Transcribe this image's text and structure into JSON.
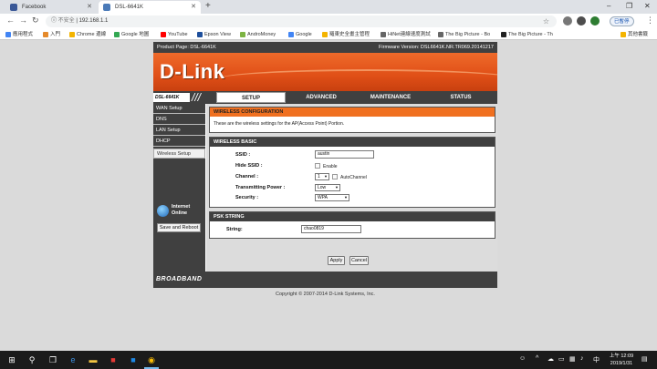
{
  "browser": {
    "tabs": [
      {
        "label": "Facebook",
        "color": "#3b5998"
      },
      {
        "label": "DSL-6641K",
        "color": "#4a7ab8"
      }
    ],
    "new_tab": "+",
    "window_controls": {
      "minimize": "–",
      "maximize": "❐",
      "close": "✕"
    },
    "url_insecure": "不安全",
    "url": "192.168.1.1",
    "profile_label": "已暫停",
    "bookmarks": [
      {
        "label": "應用程式",
        "color": "#4285f4"
      },
      {
        "label": "入門",
        "color": "#e58a2b"
      },
      {
        "label": "Chrome 邊線",
        "color": "#f4b400"
      },
      {
        "label": "Google 地圖",
        "color": "#34a853"
      },
      {
        "label": "YouTube",
        "color": "#ff0000"
      },
      {
        "label": "Epson View",
        "color": "#1e4f9c"
      },
      {
        "label": "AndroMoney",
        "color": "#7cb342"
      },
      {
        "label": "Google",
        "color": "#4285f4"
      },
      {
        "label": "羅東史全畫主管程",
        "color": "#f4b400"
      },
      {
        "label": "HiNet連線速度測試",
        "color": "#666666"
      },
      {
        "label": "The Big Picture - Bo",
        "color": "#666666"
      },
      {
        "label": "The Big Picture - Th",
        "color": "#222222"
      }
    ],
    "bookmarks_other": "其他書籤"
  },
  "router": {
    "product_page": "Product Page: DSL-6641K",
    "firmware": "Firmware Version: DSL6641K.NR.TR069.20141217",
    "logo": "D-Link",
    "model_badge": "DSL-6641K",
    "slashes": "///",
    "main_tabs": [
      "SETUP",
      "ADVANCED",
      "MAINTENANCE",
      "STATUS"
    ],
    "left_nav": [
      "WAN Setup",
      "DNS",
      "LAN Setup",
      "DHCP",
      "Wireless Setup"
    ],
    "status_line1": "Internet",
    "status_line2": "Online",
    "save_reboot": "Save and Reboot",
    "wireless_config": {
      "title": "WIRELESS CONFIGURATION",
      "description": "These are the wireless settings for the AP(Access Point) Portion."
    },
    "wireless_basic": {
      "title": "WIRELESS BASIC",
      "ssid_label": "SSID :",
      "ssid_value": "austin",
      "hide_ssid_label": "Hide SSID :",
      "hide_ssid_option": "Enable",
      "channel_label": "Channel :",
      "channel_value": "1",
      "auto_channel": "AutoChannel",
      "power_label": "Transmitting Power :",
      "power_value": "Low",
      "security_label": "Security :",
      "security_value": "WPA"
    },
    "psk": {
      "title": "PSK STRING",
      "string_label": "String:",
      "string_value": "chao0819"
    },
    "apply": "Apply",
    "cancel": "Cancel",
    "footer_brand": "BROADBAND",
    "copyright": "Copyright © 2007-2014 D-Link Systems, Inc."
  },
  "taskbar": {
    "time": "上午 12:09",
    "date": "2019/1/31",
    "ime": "中"
  }
}
